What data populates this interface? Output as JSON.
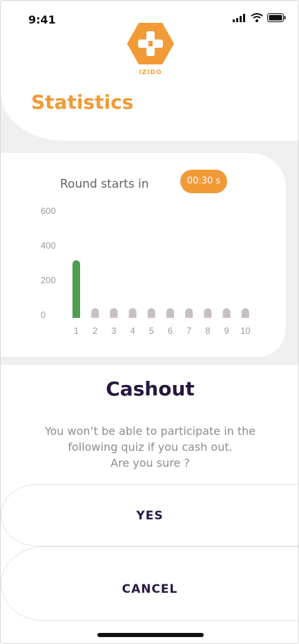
{
  "status_bar": {
    "time": "9:41"
  },
  "brand": {
    "logo_text": "IZIDO",
    "accent": "#f29a36"
  },
  "header": {
    "title": "Statistics"
  },
  "round": {
    "label": "Round starts in",
    "timer": "00:30 s"
  },
  "chart_data": {
    "type": "bar",
    "categories": [
      "1",
      "2",
      "3",
      "4",
      "5",
      "6",
      "7",
      "8",
      "9",
      "10"
    ],
    "values": [
      360,
      60,
      60,
      60,
      60,
      60,
      60,
      60,
      60,
      60
    ],
    "y_ticks": [
      "600",
      "400",
      "200",
      "0"
    ],
    "ylim": [
      0,
      600
    ],
    "colors": {
      "highlight": "#4f9d4f",
      "default": "#c9bfc1"
    },
    "highlight_index": 0
  },
  "cashout": {
    "title": "Cashout",
    "message_line1": "You won’t be able to participate in the",
    "message_line2": "following quiz if you cash out.",
    "message_line3": "Are you sure ?",
    "yes_label": "YES",
    "cancel_label": "CANCEL"
  }
}
